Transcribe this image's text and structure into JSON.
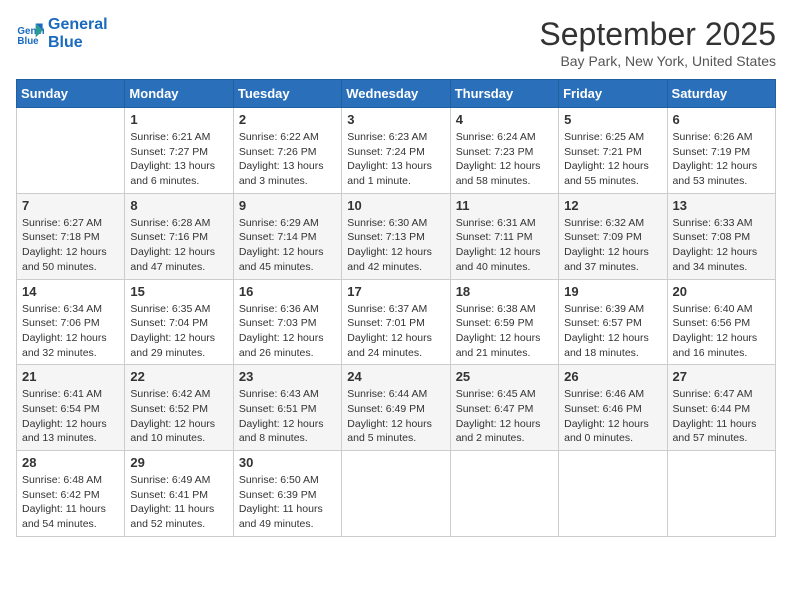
{
  "header": {
    "logo_line1": "General",
    "logo_line2": "Blue",
    "month": "September 2025",
    "location": "Bay Park, New York, United States"
  },
  "weekdays": [
    "Sunday",
    "Monday",
    "Tuesday",
    "Wednesday",
    "Thursday",
    "Friday",
    "Saturday"
  ],
  "weeks": [
    [
      {
        "day": "",
        "info": ""
      },
      {
        "day": "1",
        "info": "Sunrise: 6:21 AM\nSunset: 7:27 PM\nDaylight: 13 hours\nand 6 minutes."
      },
      {
        "day": "2",
        "info": "Sunrise: 6:22 AM\nSunset: 7:26 PM\nDaylight: 13 hours\nand 3 minutes."
      },
      {
        "day": "3",
        "info": "Sunrise: 6:23 AM\nSunset: 7:24 PM\nDaylight: 13 hours\nand 1 minute."
      },
      {
        "day": "4",
        "info": "Sunrise: 6:24 AM\nSunset: 7:23 PM\nDaylight: 12 hours\nand 58 minutes."
      },
      {
        "day": "5",
        "info": "Sunrise: 6:25 AM\nSunset: 7:21 PM\nDaylight: 12 hours\nand 55 minutes."
      },
      {
        "day": "6",
        "info": "Sunrise: 6:26 AM\nSunset: 7:19 PM\nDaylight: 12 hours\nand 53 minutes."
      }
    ],
    [
      {
        "day": "7",
        "info": "Sunrise: 6:27 AM\nSunset: 7:18 PM\nDaylight: 12 hours\nand 50 minutes."
      },
      {
        "day": "8",
        "info": "Sunrise: 6:28 AM\nSunset: 7:16 PM\nDaylight: 12 hours\nand 47 minutes."
      },
      {
        "day": "9",
        "info": "Sunrise: 6:29 AM\nSunset: 7:14 PM\nDaylight: 12 hours\nand 45 minutes."
      },
      {
        "day": "10",
        "info": "Sunrise: 6:30 AM\nSunset: 7:13 PM\nDaylight: 12 hours\nand 42 minutes."
      },
      {
        "day": "11",
        "info": "Sunrise: 6:31 AM\nSunset: 7:11 PM\nDaylight: 12 hours\nand 40 minutes."
      },
      {
        "day": "12",
        "info": "Sunrise: 6:32 AM\nSunset: 7:09 PM\nDaylight: 12 hours\nand 37 minutes."
      },
      {
        "day": "13",
        "info": "Sunrise: 6:33 AM\nSunset: 7:08 PM\nDaylight: 12 hours\nand 34 minutes."
      }
    ],
    [
      {
        "day": "14",
        "info": "Sunrise: 6:34 AM\nSunset: 7:06 PM\nDaylight: 12 hours\nand 32 minutes."
      },
      {
        "day": "15",
        "info": "Sunrise: 6:35 AM\nSunset: 7:04 PM\nDaylight: 12 hours\nand 29 minutes."
      },
      {
        "day": "16",
        "info": "Sunrise: 6:36 AM\nSunset: 7:03 PM\nDaylight: 12 hours\nand 26 minutes."
      },
      {
        "day": "17",
        "info": "Sunrise: 6:37 AM\nSunset: 7:01 PM\nDaylight: 12 hours\nand 24 minutes."
      },
      {
        "day": "18",
        "info": "Sunrise: 6:38 AM\nSunset: 6:59 PM\nDaylight: 12 hours\nand 21 minutes."
      },
      {
        "day": "19",
        "info": "Sunrise: 6:39 AM\nSunset: 6:57 PM\nDaylight: 12 hours\nand 18 minutes."
      },
      {
        "day": "20",
        "info": "Sunrise: 6:40 AM\nSunset: 6:56 PM\nDaylight: 12 hours\nand 16 minutes."
      }
    ],
    [
      {
        "day": "21",
        "info": "Sunrise: 6:41 AM\nSunset: 6:54 PM\nDaylight: 12 hours\nand 13 minutes."
      },
      {
        "day": "22",
        "info": "Sunrise: 6:42 AM\nSunset: 6:52 PM\nDaylight: 12 hours\nand 10 minutes."
      },
      {
        "day": "23",
        "info": "Sunrise: 6:43 AM\nSunset: 6:51 PM\nDaylight: 12 hours\nand 8 minutes."
      },
      {
        "day": "24",
        "info": "Sunrise: 6:44 AM\nSunset: 6:49 PM\nDaylight: 12 hours\nand 5 minutes."
      },
      {
        "day": "25",
        "info": "Sunrise: 6:45 AM\nSunset: 6:47 PM\nDaylight: 12 hours\nand 2 minutes."
      },
      {
        "day": "26",
        "info": "Sunrise: 6:46 AM\nSunset: 6:46 PM\nDaylight: 12 hours\nand 0 minutes."
      },
      {
        "day": "27",
        "info": "Sunrise: 6:47 AM\nSunset: 6:44 PM\nDaylight: 11 hours\nand 57 minutes."
      }
    ],
    [
      {
        "day": "28",
        "info": "Sunrise: 6:48 AM\nSunset: 6:42 PM\nDaylight: 11 hours\nand 54 minutes."
      },
      {
        "day": "29",
        "info": "Sunrise: 6:49 AM\nSunset: 6:41 PM\nDaylight: 11 hours\nand 52 minutes."
      },
      {
        "day": "30",
        "info": "Sunrise: 6:50 AM\nSunset: 6:39 PM\nDaylight: 11 hours\nand 49 minutes."
      },
      {
        "day": "",
        "info": ""
      },
      {
        "day": "",
        "info": ""
      },
      {
        "day": "",
        "info": ""
      },
      {
        "day": "",
        "info": ""
      }
    ]
  ]
}
